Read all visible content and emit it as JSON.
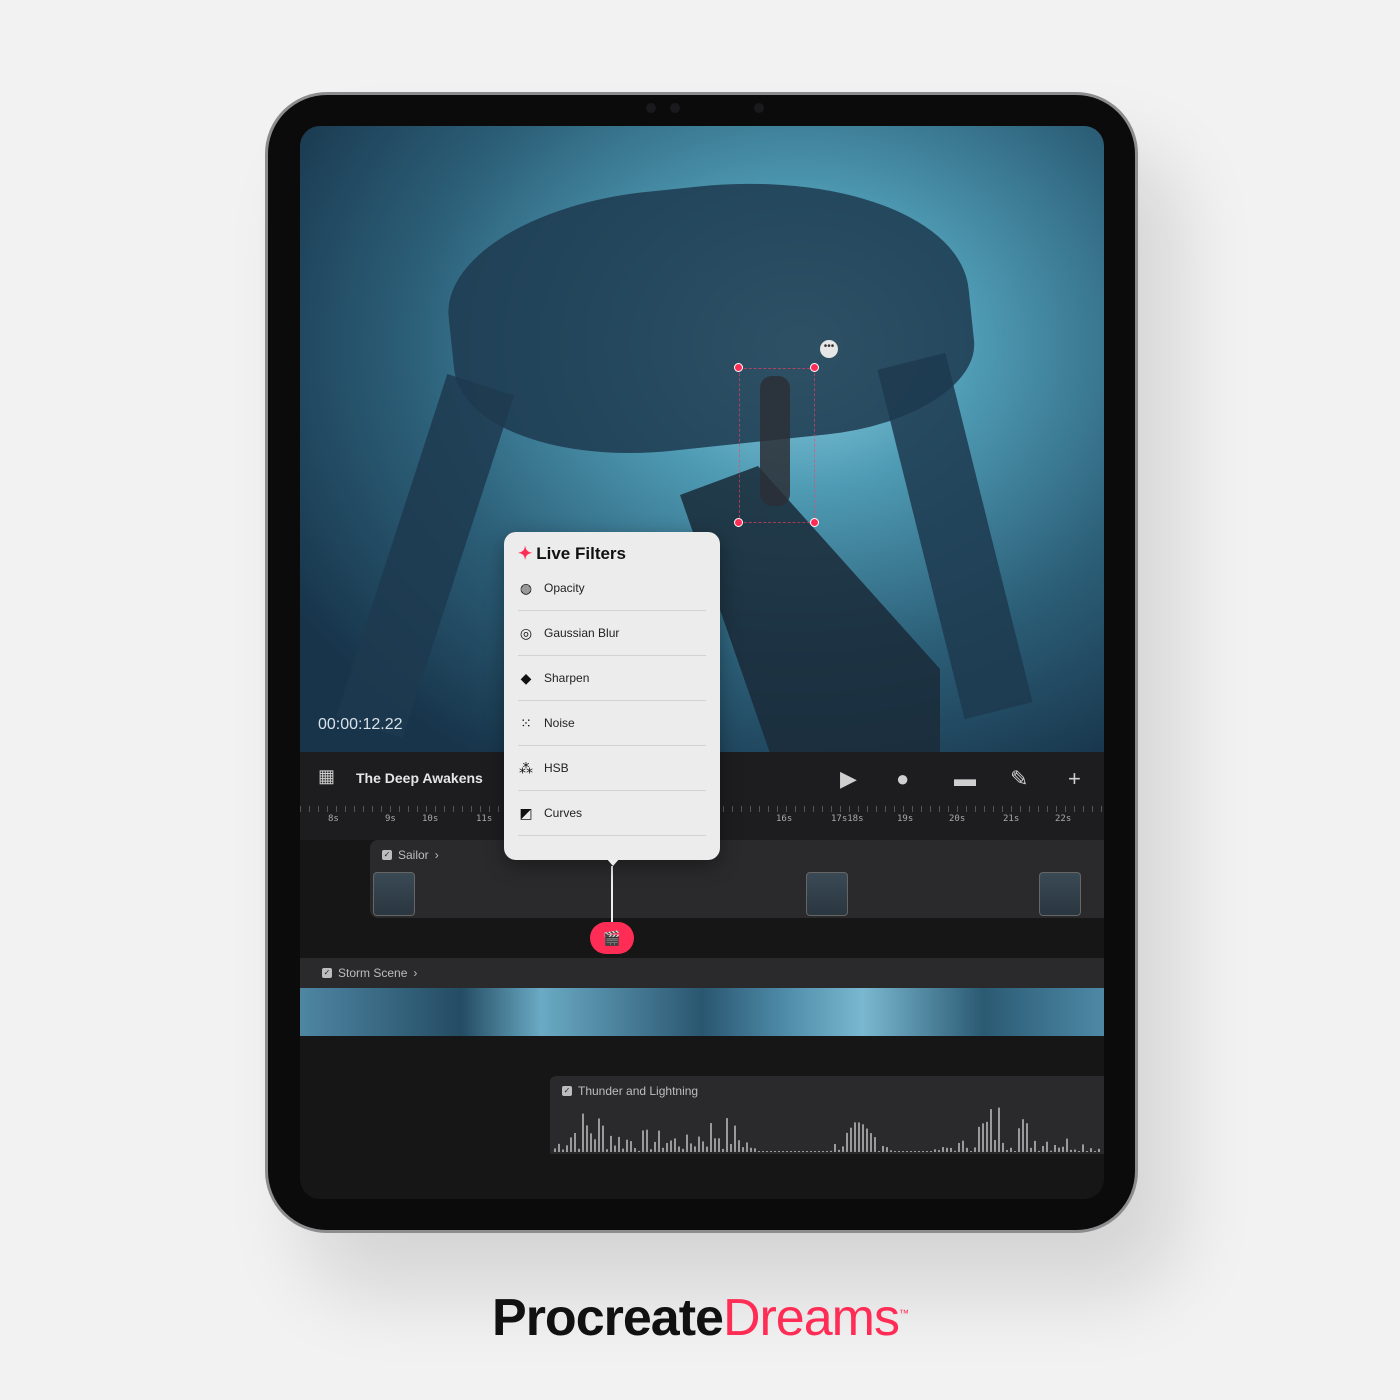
{
  "canvas": {
    "timecode": "00:00:12.22",
    "more_label": "•••"
  },
  "toolbar": {
    "project_title": "The Deep Awakens",
    "icons": [
      "play-icon",
      "record-icon",
      "layers-icon",
      "draw-icon",
      "add-icon"
    ]
  },
  "ruler": {
    "ticks": [
      "8s",
      "9s",
      "10s",
      "11s",
      "16s",
      "17s18s",
      "19s",
      "20s",
      "21s",
      "22s"
    ]
  },
  "tracks": {
    "sailor": "Sailor",
    "storm": "Storm Scene",
    "thunder": "Thunder and Lightning"
  },
  "popup": {
    "title": "Live Filters",
    "items": [
      {
        "label": "Opacity",
        "icon": "opacity-icon"
      },
      {
        "label": "Gaussian Blur",
        "icon": "blur-icon"
      },
      {
        "label": "Sharpen",
        "icon": "sharpen-icon"
      },
      {
        "label": "Noise",
        "icon": "noise-icon"
      },
      {
        "label": "HSB",
        "icon": "hsb-icon"
      },
      {
        "label": "Curves",
        "icon": "curves-icon"
      }
    ]
  },
  "brand": {
    "part1": "Procreate",
    "part2": "Dreams",
    "tm": "™"
  },
  "colors": {
    "accent": "#ff2d55"
  }
}
